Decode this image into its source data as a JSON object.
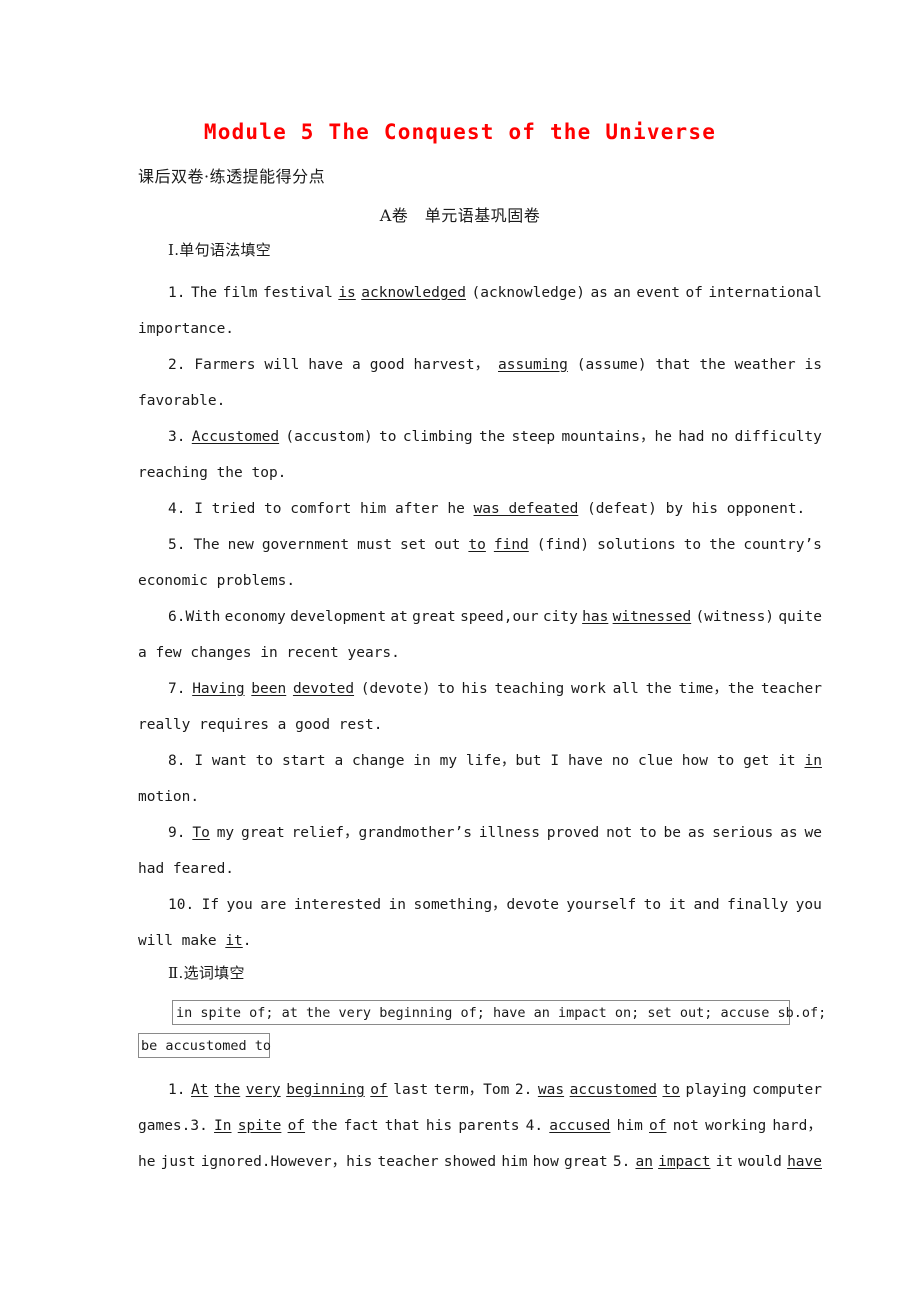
{
  "title": "Module 5 The Conquest of the Universe",
  "title_color": "#ff0000",
  "subtitle_cn": "课后双卷·练透提能得分点",
  "banner_cn": "A卷　单元语基巩固卷",
  "sections": [
    {
      "id": "section-1",
      "heading": "Ⅰ.单句语法填空"
    },
    {
      "id": "section-2",
      "heading": "Ⅱ.选词填空"
    }
  ],
  "grammar_items": [
    {
      "number": "1.",
      "lines": [
        [
          {
            "t": "1. The film festival "
          },
          {
            "t": "is acknowledged",
            "u": true
          },
          {
            "t": "(acknowledge) as an event of international"
          }
        ],
        [
          {
            "t": "importance."
          }
        ]
      ]
    },
    {
      "number": "2.",
      "lines": [
        [
          {
            "t": "2. Farmers will have a good harvest，"
          },
          {
            "t": "assuming",
            "u": true
          },
          {
            "t": "(assume) that the weather is"
          }
        ],
        [
          {
            "t": "favorable."
          }
        ]
      ]
    },
    {
      "number": "3.",
      "lines": [
        [
          {
            "t": "3. "
          },
          {
            "t": "Accustomed",
            "u": true
          },
          {
            "t": " (accustom) to climbing the steep mountains，he had no difficulty"
          }
        ],
        [
          {
            "t": "reaching the top."
          }
        ]
      ]
    },
    {
      "number": "4.",
      "lines": [
        [
          {
            "t": "4. I tried to comfort him after he "
          },
          {
            "t": "was defeated",
            "u": true
          },
          {
            "t": " (defeat) by his opponent."
          }
        ]
      ]
    },
    {
      "number": "5.",
      "lines": [
        [
          {
            "t": "5. The new government must set out "
          },
          {
            "t": "to find",
            "u": true
          },
          {
            "t": " (find) solutions to the country’s"
          }
        ],
        [
          {
            "t": "economic problems."
          }
        ]
      ]
    },
    {
      "number": "6.",
      "lines": [
        [
          {
            "t": "6.With economy development at great speed,our city "
          },
          {
            "t": "has witnessed",
            "u": true
          },
          {
            "t": " (witness) quite"
          }
        ],
        [
          {
            "t": "a few changes in recent years."
          }
        ]
      ]
    },
    {
      "number": "7.",
      "lines": [
        [
          {
            "t": "7. "
          },
          {
            "t": "Having been devoted",
            "u": true
          },
          {
            "t": " (devote) to his teaching work all the time，the teacher"
          }
        ],
        [
          {
            "t": "really requires a good rest."
          }
        ]
      ]
    },
    {
      "number": "8.",
      "lines": [
        [
          {
            "t": "8. I want to start a change in my life，but I have no clue how to get it "
          },
          {
            "t": "in",
            "u": true
          }
        ],
        [
          {
            "t": "motion."
          }
        ]
      ]
    },
    {
      "number": "9.",
      "lines": [
        [
          {
            "t": "9. "
          },
          {
            "t": "To",
            "u": true
          },
          {
            "t": " my great relief，grandmother’s illness proved not to be as serious as we"
          }
        ],
        [
          {
            "t": "had feared."
          }
        ]
      ]
    },
    {
      "number": "10.",
      "lines": [
        [
          {
            "t": "10. If you are interested in something，devote yourself to it and finally you"
          }
        ],
        [
          {
            "t": "will make "
          },
          {
            "t": "it",
            "u": true
          },
          {
            "t": "."
          }
        ]
      ]
    }
  ],
  "word_bank": {
    "line1": "in spite of; at the very beginning of; have an impact on; set out; accuse sb.of;",
    "line2": "be accustomed to"
  },
  "cloze_paragraph": {
    "lines": [
      [
        {
          "t": "1. "
        },
        {
          "t": "At the very beginning of",
          "u": true
        },
        {
          "t": " last term，Tom 2."
        },
        {
          "t": "was accustomed to",
          "u": true
        },
        {
          "t": " playing computer"
        }
      ],
      [
        {
          "t": "games.3."
        },
        {
          "t": "In spite of",
          "u": true
        },
        {
          "t": " the fact that his parents 4."
        },
        {
          "t": "accused",
          "u": true
        },
        {
          "t": " him "
        },
        {
          "t": "of",
          "u": true
        },
        {
          "t": " not working hard，"
        }
      ],
      [
        {
          "t": "he just ignored.However，his teacher showed him how great 5."
        },
        {
          "t": "an impact",
          "u": true
        },
        {
          "t": " it would "
        },
        {
          "t": "have",
          "u": true
        }
      ]
    ]
  }
}
